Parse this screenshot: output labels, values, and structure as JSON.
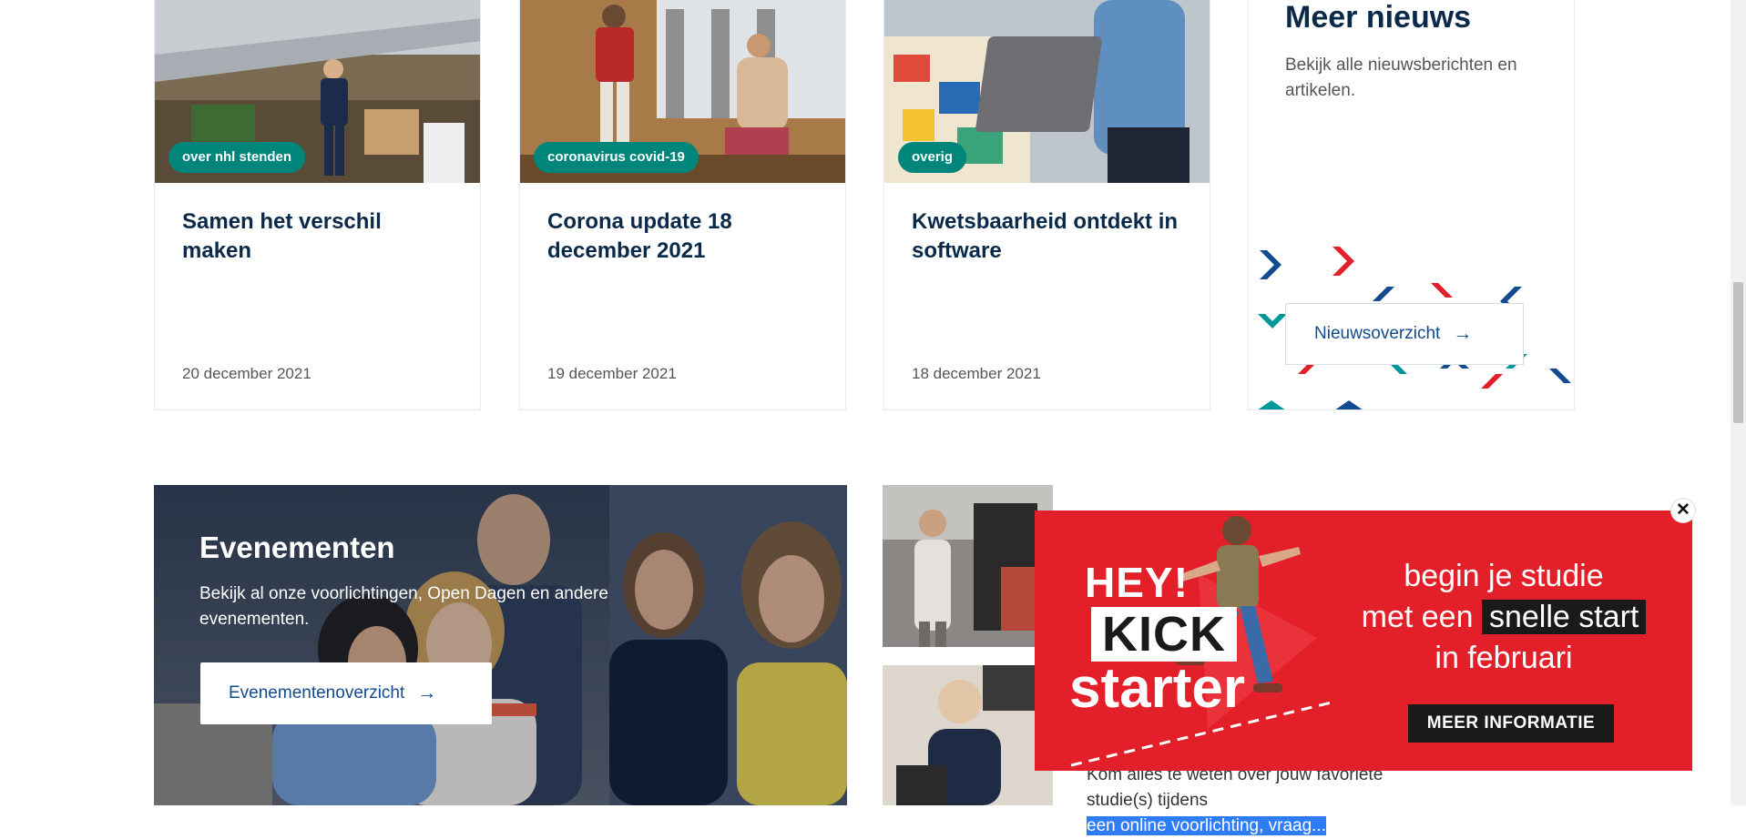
{
  "news": {
    "cards": [
      {
        "tag": "over nhl stenden",
        "title": "Samen het verschil maken",
        "date": "20 december 2021"
      },
      {
        "tag": "coronavirus covid-19",
        "title": "Corona update 18 december 2021",
        "date": "19 december 2021"
      },
      {
        "tag": "overig",
        "title": "Kwetsbaarheid ontdekt in software",
        "date": "18 december 2021"
      }
    ],
    "more": {
      "title": "Meer nieuws",
      "description": "Bekijk alle nieuwsberichten en artikelen.",
      "button": "Nieuwsoverzicht"
    }
  },
  "events": {
    "title": "Evenementen",
    "description": "Bekijk al onze voorlichtingen, Open Dagen en andere evenementen.",
    "button": "Evenementenoverzicht"
  },
  "lower_text": {
    "line1": "Kom alles te weten over jouw favoriete studie(s) tijdens",
    "line2_highlighted": "een online voorlichting, vraag..."
  },
  "banner": {
    "hey": "HEY!",
    "kick": "KICK",
    "starter": "starter",
    "line1": "begin je studie",
    "line2_prefix": "met een",
    "line2_box": "snelle start",
    "line3": "in februari",
    "cta": "MEER INFORMATIE",
    "close": "✕"
  },
  "colors": {
    "brand_navy": "#0b2a4a",
    "tag_teal": "#00857a",
    "link_blue": "#124b8e",
    "banner_red": "#e3202a",
    "selection_blue": "#2f7df6"
  },
  "icons": {
    "arrow": "→"
  }
}
